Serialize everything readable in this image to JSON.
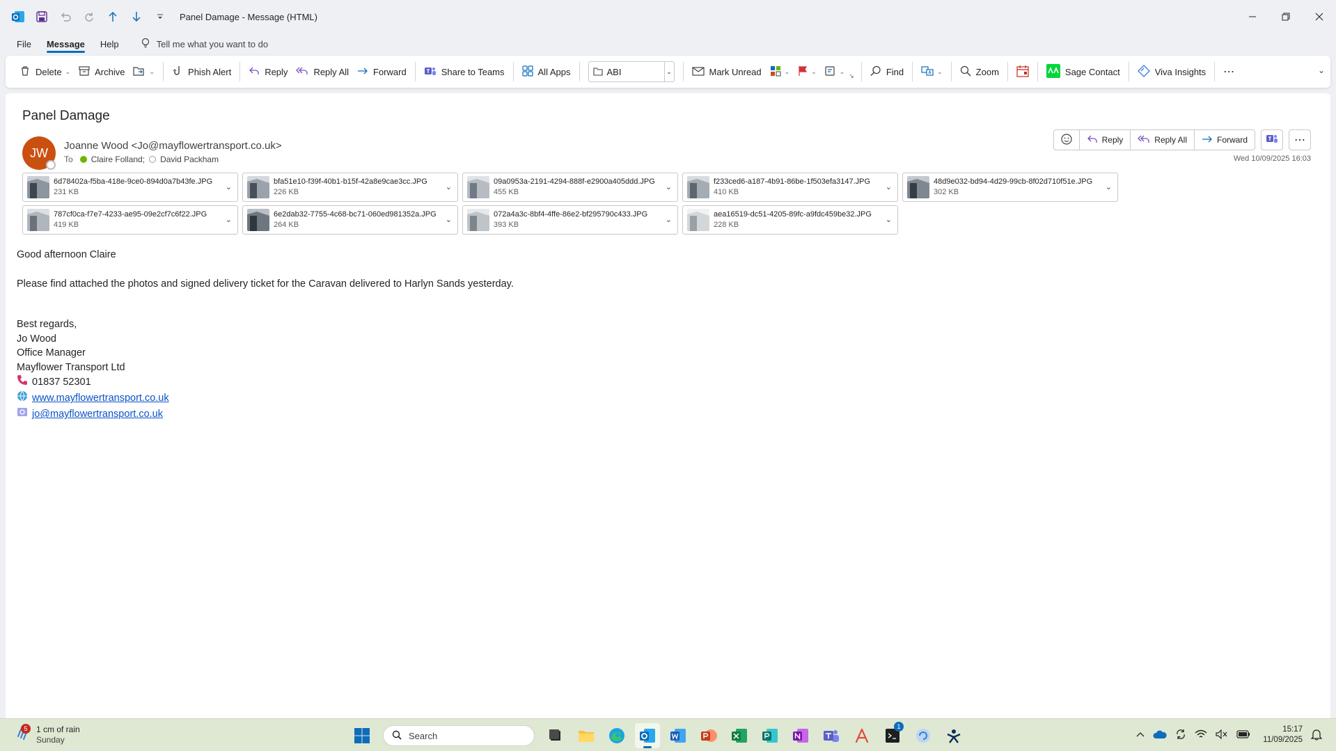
{
  "window": {
    "title": "Panel Damage  -  Message (HTML)"
  },
  "menu": {
    "tabs": [
      "File",
      "Message",
      "Help"
    ],
    "tell_me": "Tell me what you want to do"
  },
  "ribbon": {
    "delete": "Delete",
    "archive": "Archive",
    "phish_alert": "Phish Alert",
    "reply": "Reply",
    "reply_all": "Reply All",
    "forward": "Forward",
    "share_to_teams": "Share to Teams",
    "all_apps": "All Apps",
    "move_folder": "ABI",
    "mark_unread": "Mark Unread",
    "find": "Find",
    "zoom": "Zoom",
    "sage_contact": "Sage Contact",
    "viva_insights": "Viva Insights"
  },
  "message": {
    "subject": "Panel Damage",
    "avatar_initials": "JW",
    "sender": "Joanne Wood <Jo@mayflowertransport.co.uk>",
    "to_label": "To",
    "recipients": [
      "Claire Folland;",
      "David Packham"
    ],
    "datetime": "Wed 10/09/2025 16:03",
    "actions": {
      "reply": "Reply",
      "reply_all": "Reply All",
      "forward": "Forward"
    },
    "attachments": [
      {
        "name": "6d78402a-f5ba-418e-9ce0-894d0a7b43fe.JPG",
        "size": "231 KB"
      },
      {
        "name": "bfa51e10-f39f-40b1-b15f-42a8e9cae3cc.JPG",
        "size": "226 KB"
      },
      {
        "name": "09a0953a-2191-4294-888f-e2900a405ddd.JPG",
        "size": "455 KB"
      },
      {
        "name": "f233ced6-a187-4b91-86be-1f503efa3147.JPG",
        "size": "410 KB"
      },
      {
        "name": "48d9e032-bd94-4d29-99cb-8f02d710f51e.JPG",
        "size": "302 KB"
      },
      {
        "name": "787cf0ca-f7e7-4233-ae95-09e2cf7c6f22.JPG",
        "size": "419 KB"
      },
      {
        "name": "6e2dab32-7755-4c68-bc71-060ed981352a.JPG",
        "size": "264 KB"
      },
      {
        "name": "072a4a3c-8bf4-4ffe-86e2-bf295790c433.JPG",
        "size": "393 KB"
      },
      {
        "name": "aea16519-dc51-4205-89fc-a9fdc459be32.JPG",
        "size": "228 KB"
      }
    ],
    "body": {
      "greeting": "Good afternoon Claire",
      "text": "Please find attached the photos and signed delivery ticket for the Caravan delivered to Harlyn Sands yesterday.",
      "signoff": "Best regards,",
      "sig_name": "Jo Wood",
      "sig_title": "Office Manager",
      "sig_company": "Mayflower Transport Ltd",
      "sig_phone": "01837 52301",
      "sig_web": "www.mayflowertransport.co.uk",
      "sig_email": "jo@mayflowertransport.co.uk"
    }
  },
  "taskbar": {
    "weather_badge": "5",
    "weather_text": "1 cm of rain",
    "weather_day": "Sunday",
    "search_placeholder": "Search",
    "teams_badge": "1",
    "time": "15:17",
    "date": "11/09/2025"
  },
  "colors": {
    "accent": "#0f6cbd",
    "avatar": "#ca5010",
    "taskbar": "#dfe8d3",
    "link": "#0b52c9"
  }
}
